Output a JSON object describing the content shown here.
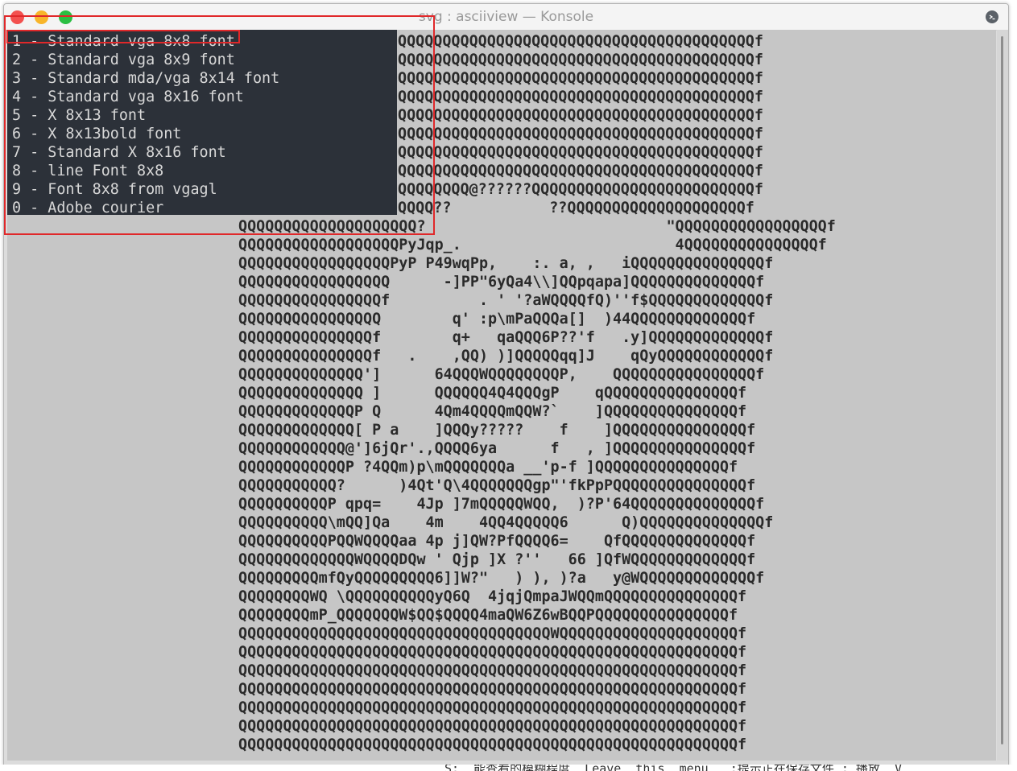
{
  "window": {
    "title": "svg : asciiview — Konsole"
  },
  "menu": {
    "items": [
      "1 - Standard vga 8x8 font",
      "2 - Standard vga 8x9 font",
      "3 - Standard mda/vga 8x14 font",
      "4 - Standard vga 8x16 font",
      "5 - X 8x13 font",
      "6 - X 8x13bold font",
      "7 - Standard X 8x16 font",
      "8 - line Font 8x8",
      "9 - Font 8x8 from vgagl",
      "0 - Adobe courier"
    ]
  },
  "art": {
    "lines": [
      "QQQQQQQQQQQQQQQQQQQQQQQQQQQQQQQQQQQQQQQQf",
      "QQQQQQQQQQQQQQQQQQQQQQQQQQQQQQQQQQQQQQQQf",
      "QQQQQQQQQQQQQQQQQQQQQQQQQQQQQQQQQQQQQQQQf",
      "QQQQQQQQQQQQQQQQQQQQQQQQQQQQQQQQQQQQQQQQf",
      "QQQQQQQQQQQQQQQQQQQQQQQQQQQQQQQQQQQQQQQQf",
      "QQQQQQQQQQQQQQQQQQQQQQQQQQQQQQQQQQQQQQQQf",
      "QQQQQQQQQQQQQQQQQQQQQQQQQQQQQQQQQQQQQQQQf",
      "QQQQQQQQQQQQQQQQQQQQQQQQQQQQQQQQQQQQQQQQf",
      "QQQQQQQQ@??????QQQQQQQQQQQQQQQQQQQQQQQQQf",
      "QQQQ??           ??QQQQQQQQQQQQQQQQQQQQf",
      "QQQQQQQQQQQQQQQQQQQQ?                           \"QQQQQQQQQQQQQQQQQf",
      "QQQQQQQQQQQQQQQQQQPyJqp_.                        4QQQQQQQQQQQQQQQf",
      "QQQQQQQQQQQQQQQQQPyP P49wqPp,    :. a, ,   iQQQQQQQQQQQQQQQf",
      "QQQQQQQQQQQQQQQQQ      -]PP\"6yQa4\\\\]QQpqapa]QQQQQQQQQQQQQQf",
      "QQQQQQQQQQQQQQQQf          . ' '?aWQQQQfQ)''f$QQQQQQQQQQQQQf",
      "QQQQQQQQQQQQQQQQ        q' :p\\mPaQQQa[]  )44QQQQQQQQQQQQQf",
      "QQQQQQQQQQQQQQQf        q+   qaQQQ6P??'f   .y]QQQQQQQQQQQQQf",
      "QQQQQQQQQQQQQQQf   .    ,QQ) )]QQQQQqq]J    qQyQQQQQQQQQQQQf",
      "QQQQQQQQQQQQQQ']      64QQQWQQQQQQQQP,    QQQQQQQQQQQQQQQQf",
      "QQQQQQQQQQQQQQ ]      QQQQQQ4Q4QQQgP    qQQQQQQQQQQQQQQQf",
      "QQQQQQQQQQQQQP Q      4Qm4QQQQmQQW?`    ]QQQQQQQQQQQQQQQf",
      "QQQQQQQQQQQQQ[ P a    ]QQQy?????    f    ]QQQQQQQQQQQQQQQf",
      "QQQQQQQQQQQQ@']6jQr'.,QQQQ6ya      f   , ]QQQQQQQQQQQQQQQf",
      "QQQQQQQQQQQQP ?4QQm)p\\mQQQQQQQa __'p-f ]QQQQQQQQQQQQQQQf",
      "QQQQQQQQQQQ?      )4Qt'Q\\4QQQQQQQgp\"'fkPpPQQQQQQQQQQQQQQQf",
      "QQQQQQQQQQP qpq=    4Jp ]7mQQQQQWQQ,  )?P'64QQQQQQQQQQQQQQf",
      "QQQQQQQQQQ\\mQQ]Qa    4m    4QQ4QQQQQ6      Q)QQQQQQQQQQQQQQf",
      "QQQQQQQQQQPQQWQQQQaa 4p j]QW?PfQQQQ6=    QfQQQQQQQQQQQQQQf",
      "QQQQQQQQQQQQQWQQQQDQw ' Qjp ]X ?''   66 ]QfWQQQQQQQQQQQQQf",
      "QQQQQQQQQmfQyQQQQQQQQQ6]]W?\"   ) ), )?a   y@WQQQQQQQQQQQQQf",
      "QQQQQQQQWQ \\QQQQQQQQQQyQ6Q  4jqjQmpaJWQQmQQQQQQQQQQQQQQQf",
      "QQQQQQQQmP_QQQQQQQW$QQ$QQQQ4maQW6Z6wBQQPQQQQQQQQQQQQQQQf",
      "QQQQQQQQQQQQQQQQQQQQQQQQQQQQQQQQQQQWQQQQQQQQQQQQQQQQQQQQf",
      "QQQQQQQQQQQQQQQQQQQQQQQQQQQQQQQQQQQQQQQQQQQQQQQQQQQQQQQQf",
      "QQQQQQQQQQQQQQQQQQQQQQQQQQQQQQQQQQQQQQQQQQQQQQQQQQQQQQQQf",
      "QQQQQQQQQQQQQQQQQQQQQQQQQQQQQQQQQQQQQQQQQQQQQQQQQQQQQQQQf",
      "QQQQQQQQQQQQQQQQQQQQQQQQQQQQQQQQQQQQQQQQQQQQQQQQQQQQQQQQf",
      "QQQQQQQQQQQQQQQQQQQQQQQQQQQQQQQQQQQQQQQQQQQQQQQQQQQQQQQQf",
      "QQQQQQQQQQQQQQQQQQQQQQQQQQQQQQQQQQQQQQQQQQQQQQQQQQQQQQQQf"
    ]
  },
  "status": {
    "bottom_text": "S:  能查看的模糊程度  Leave  this  menu   :提示正在保存文件 : 播放  V"
  },
  "colors": {
    "terminal_bg": "#c6c6c6",
    "menu_bg": "#2c3139",
    "highlight": "#e0282a"
  }
}
